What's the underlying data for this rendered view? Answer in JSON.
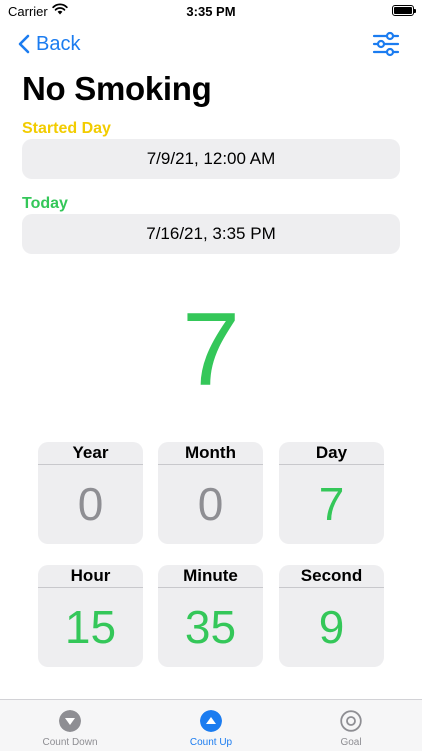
{
  "status_bar": {
    "carrier": "Carrier",
    "time": "3:35 PM"
  },
  "nav": {
    "back_label": "Back"
  },
  "page": {
    "title": "No Smoking"
  },
  "started": {
    "label": "Started Day",
    "value": "7/9/21, 12:00 AM"
  },
  "today": {
    "label": "Today",
    "value": "7/16/21, 3:35 PM"
  },
  "counter": {
    "value": "7"
  },
  "units": [
    {
      "label": "Year",
      "value": "0"
    },
    {
      "label": "Month",
      "value": "0"
    },
    {
      "label": "Day",
      "value": "7"
    },
    {
      "label": "Hour",
      "value": "15"
    },
    {
      "label": "Minute",
      "value": "35"
    },
    {
      "label": "Second",
      "value": "9"
    }
  ],
  "tabs": [
    {
      "label": "Count Down",
      "icon": "arrow-down-circle-icon"
    },
    {
      "label": "Count Up",
      "icon": "arrow-up-circle-icon"
    },
    {
      "label": "Goal",
      "icon": "target-circle-icon"
    }
  ],
  "colors": {
    "accent": "#1b7cf0",
    "started": "#f2cc00",
    "today": "#34c759",
    "zero": "#8e8e93"
  }
}
